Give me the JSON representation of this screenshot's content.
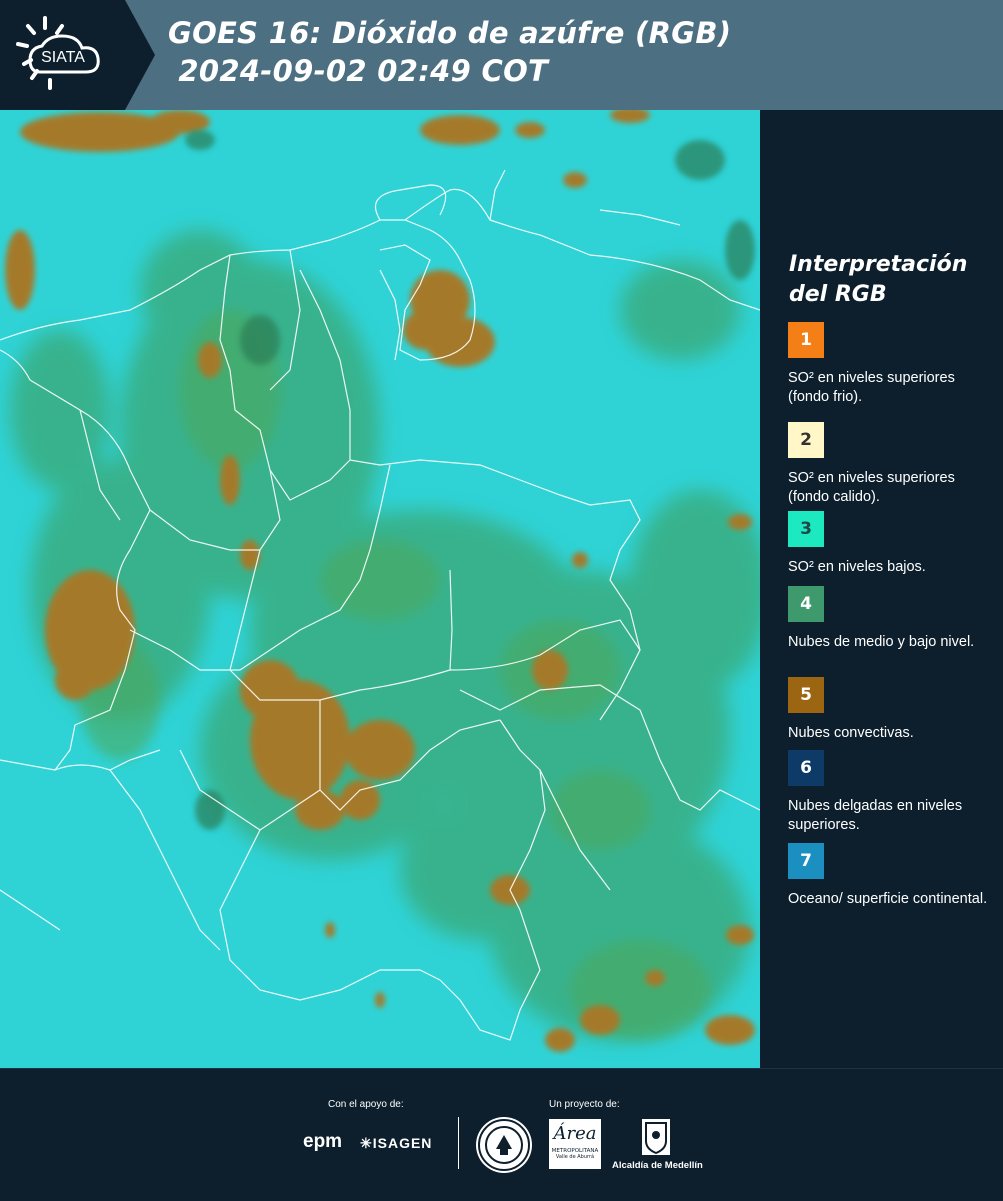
{
  "header": {
    "logo_text": "SIATA",
    "title_line1": "GOES 16: Dióxido de azúfre (RGB)",
    "title_line2": " 2024-09-02 02:49 COT"
  },
  "legend": {
    "title_line1": "Interpretación",
    "title_line2": "del RGB",
    "items": [
      {
        "num": "1",
        "color": "#f57f17",
        "text_color": "#ffffff",
        "text": "SO² en niveles superiores (fondo frio)."
      },
      {
        "num": "2",
        "color": "#fff7c8",
        "text_color": "#333333",
        "text": "SO² en niveles superiores (fondo calido)."
      },
      {
        "num": "3",
        "color": "#1de9c0",
        "text_color": "#1a4a4a",
        "text": "SO² en niveles bajos."
      },
      {
        "num": "4",
        "color": "#3e9a6c",
        "text_color": "#ffffff",
        "text": "Nubes de medio y bajo nivel."
      },
      {
        "num": "5",
        "color": "#9b6512",
        "text_color": "#ffffff",
        "text": "Nubes convectivas."
      },
      {
        "num": "6",
        "color": "#0d3a66",
        "text_color": "#ffffff",
        "text": "Nubes delgadas en niveles superiores."
      },
      {
        "num": "7",
        "color": "#1a8fc0",
        "text_color": "#ffffff",
        "text": "Oceano/ superficie continental."
      }
    ]
  },
  "footer": {
    "support_label": "Con el apoyo de:",
    "project_label": "Un proyecto de:",
    "epm": "epm",
    "isagen": "ISAGEN",
    "area_line1": "Área",
    "area_line2": "METROPOLITANA",
    "area_line3": "Valle de Aburrá",
    "alcaldia": "Alcaldía de Medellín"
  }
}
